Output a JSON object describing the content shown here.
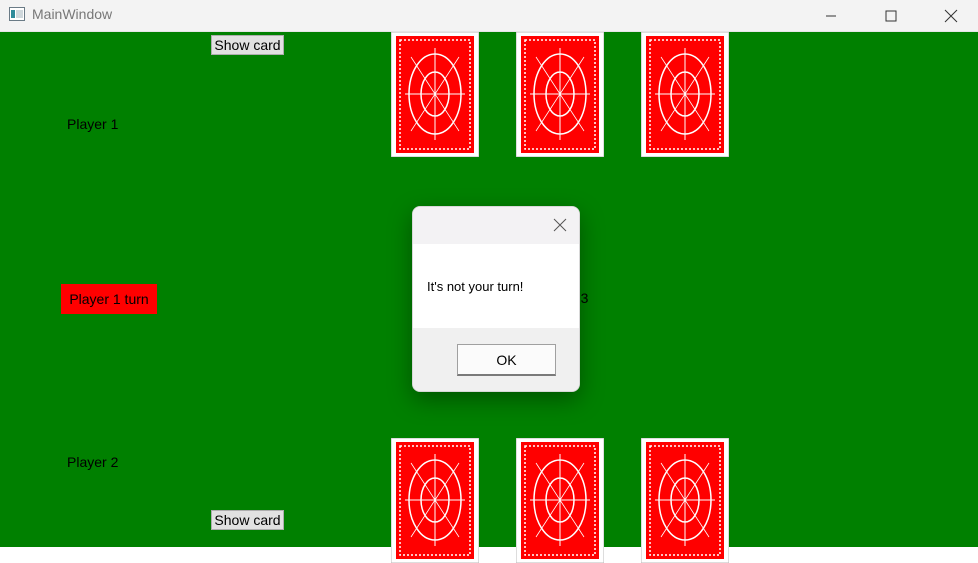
{
  "window": {
    "title": "MainWindow",
    "icon": "window-app-icon"
  },
  "controls": {
    "minimize": "minimize-icon",
    "maximize": "maximize-icon",
    "close": "close-icon"
  },
  "top": {
    "show_card_label": "Show card",
    "player_label": "Player 1"
  },
  "bottom": {
    "show_card_label": "Show card",
    "player_label": "Player 2"
  },
  "turn": {
    "label": "Player 1 turn",
    "color": "#ff0000"
  },
  "deck": {
    "count_text": ": 53"
  },
  "table": {
    "color": "#008000"
  },
  "cards": {
    "back_color": "#ff0000",
    "top_count": 3,
    "bottom_count": 3
  },
  "dialog": {
    "message": "It's not your turn!",
    "ok_label": "OK"
  }
}
